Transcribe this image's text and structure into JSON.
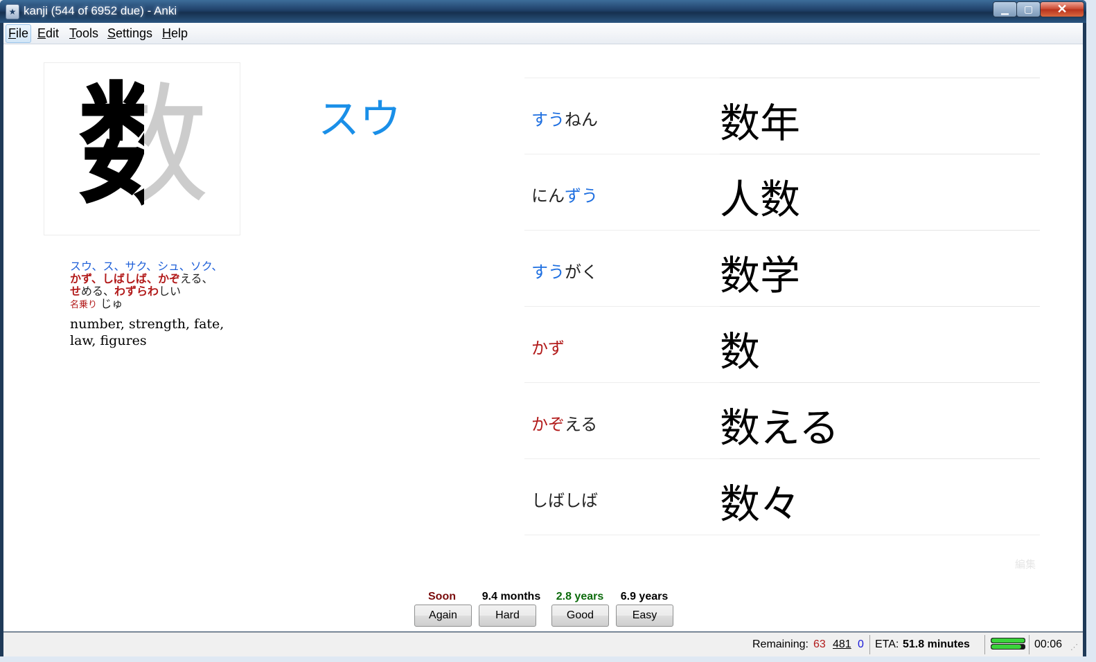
{
  "window": {
    "title": "kanji (544 of 6952 due) - Anki"
  },
  "menu": [
    {
      "label": "File",
      "key": "F",
      "rest": "ile"
    },
    {
      "label": "Edit",
      "key": "E",
      "rest": "dit"
    },
    {
      "label": "Tools",
      "key": "T",
      "rest": "ools"
    },
    {
      "label": "Settings",
      "key": "S",
      "rest": "ettings"
    },
    {
      "label": "Help",
      "key": "H",
      "rest": "elp"
    }
  ],
  "card": {
    "kanji": "数",
    "on_readings": "スウ、ス、サク、シュ、ソク、",
    "kun_line1": {
      "a": "かず",
      "b": "、",
      "c": "しばしば",
      "d": "、",
      "e": "かぞ",
      "f": "える、"
    },
    "kun_line2": {
      "a": "せ",
      "b": "める、",
      "c": "わずらわ",
      "d": "しい"
    },
    "nanori_label": "名乗り",
    "nanori": "じゅ",
    "meaning": "number, strength, fate, law, figures",
    "reading_big": "スウ",
    "edit_label": "編集"
  },
  "vocab": [
    {
      "r_hl": "すう",
      "r_rest": "ねん",
      "hl_type": "hl",
      "order": "hl-first",
      "kanji": "数年"
    },
    {
      "r_pre": "にん",
      "r_hl": "ずう",
      "hl_type": "hl",
      "order": "hl-last",
      "kanji": "人数"
    },
    {
      "r_hl": "すう",
      "r_rest": "がく",
      "hl_type": "hl",
      "order": "hl-first",
      "kanji": "数学"
    },
    {
      "r_hl": "かず",
      "r_rest": "",
      "hl_type": "red",
      "order": "hl-first",
      "kanji": "数"
    },
    {
      "r_hl": "かぞ",
      "r_rest": "える",
      "hl_type": "red",
      "order": "hl-first",
      "kanji": "数える"
    },
    {
      "r_hl": "",
      "r_rest": "しばしば",
      "hl_type": "hl",
      "order": "hl-first",
      "kanji": "数々"
    }
  ],
  "answers": [
    {
      "ease": "Soon",
      "label": "Again",
      "color": "#7a0c0c"
    },
    {
      "ease": "9.4 months",
      "label": "Hard",
      "color": "#000000"
    },
    {
      "ease": "2.8 years",
      "label": "Good",
      "color": "#0c6b0c"
    },
    {
      "ease": "6.9 years",
      "label": "Easy",
      "color": "#000000"
    }
  ],
  "status": {
    "remaining_label": "Remaining:",
    "new_count": "63",
    "review_count": "481",
    "learn_count": "0",
    "eta_label": "ETA:",
    "eta_value": "51.8 minutes",
    "timer": "00:06",
    "progress_top": 1.0,
    "progress_bottom": 0.9
  }
}
